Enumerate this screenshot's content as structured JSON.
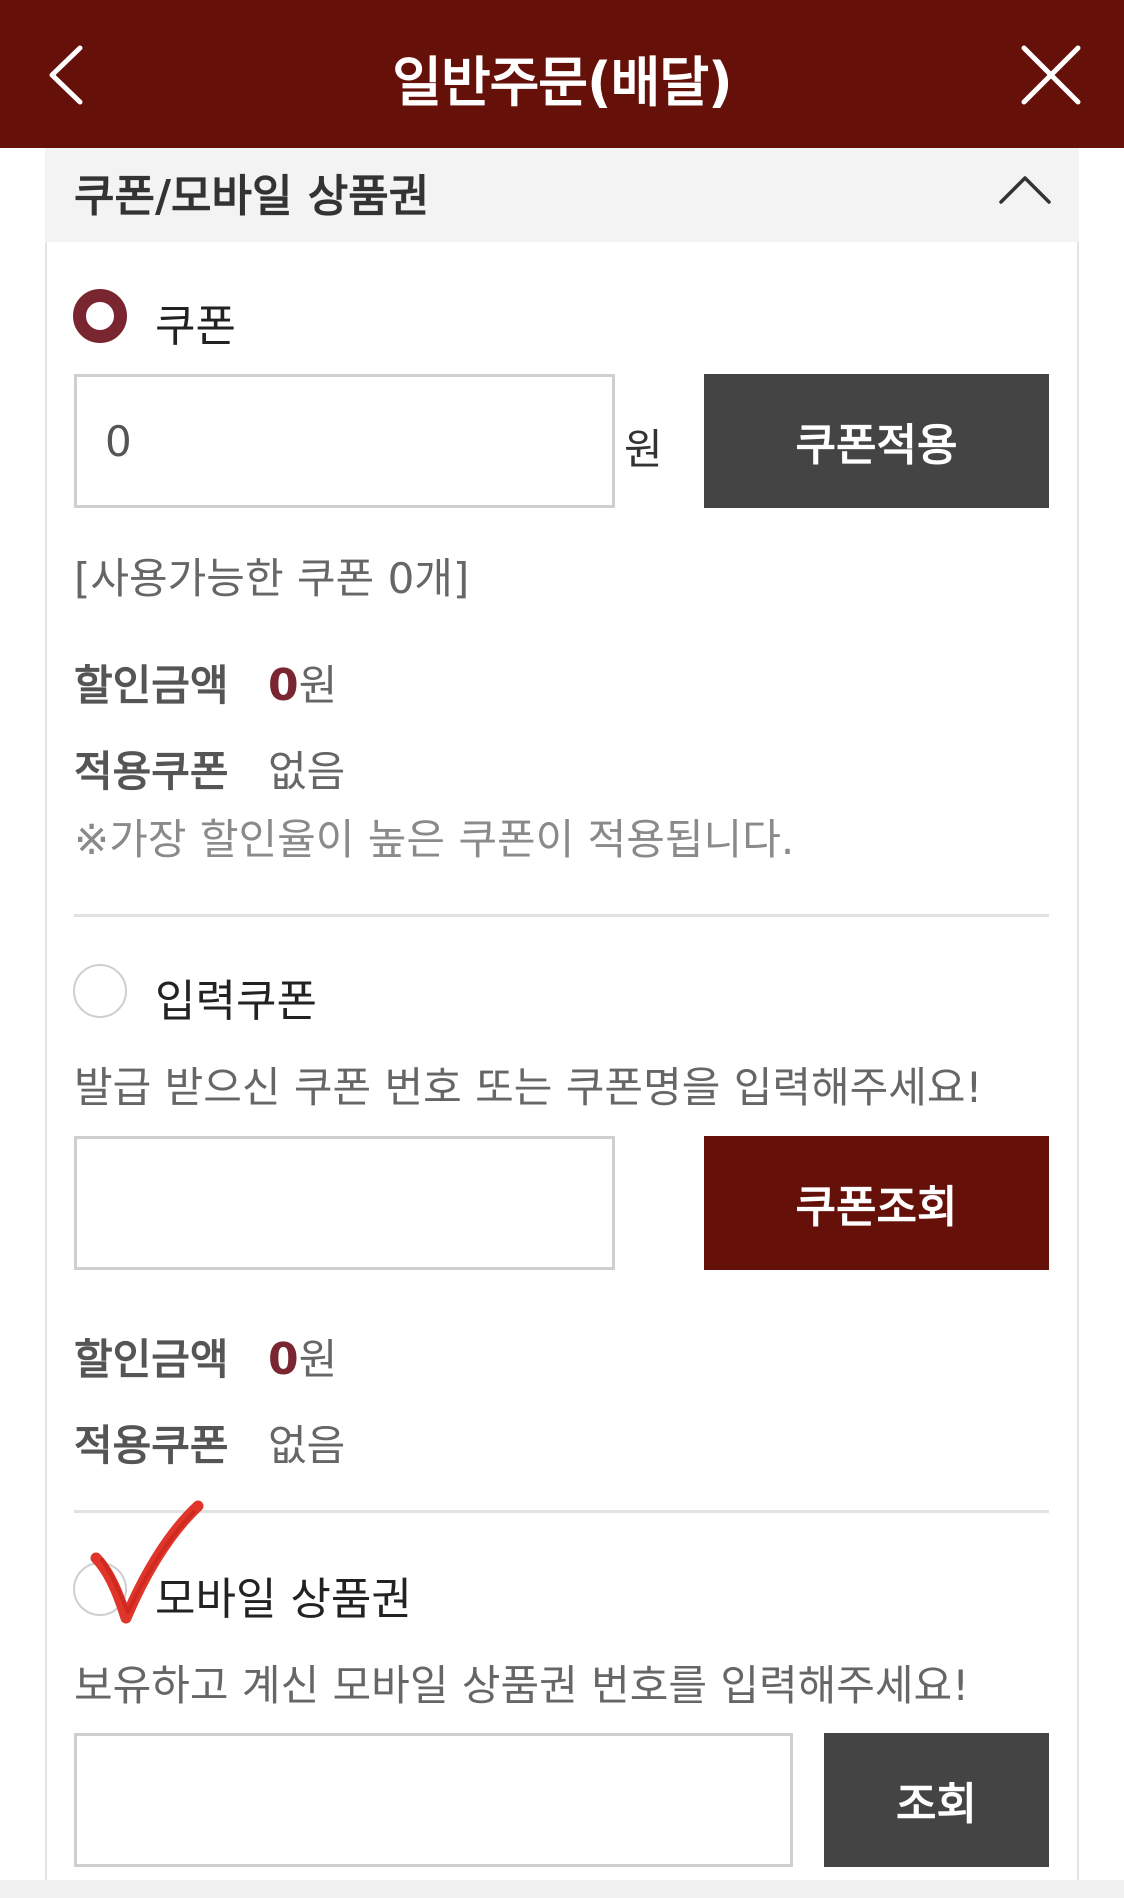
{
  "header": {
    "title": "일반주문(배달)",
    "back_icon": "chevron-left-icon",
    "close_icon": "close-icon"
  },
  "section": {
    "title": "쿠폰/모바일 상품권",
    "toggle_icon": "chevron-up-icon"
  },
  "coupon": {
    "radio_label": "쿠폰",
    "selected": true,
    "amount_value": "0",
    "unit": "원",
    "apply_button": "쿠폰적용",
    "available_text": "[사용가능한 쿠폰 0개]",
    "discount_label": "할인금액",
    "discount_value": "0",
    "discount_unit": "원",
    "applied_label": "적용쿠폰",
    "applied_value": "없음",
    "note": "※가장 할인율이 높은 쿠폰이 적용됩니다."
  },
  "input_coupon": {
    "radio_label": "입력쿠폰",
    "selected": false,
    "description": "발급 받으신 쿠폰 번호 또는 쿠폰명을 입력해주세요!",
    "input_value": "",
    "search_button": "쿠폰조회",
    "discount_label": "할인금액",
    "discount_value": "0",
    "discount_unit": "원",
    "applied_label": "적용쿠폰",
    "applied_value": "없음"
  },
  "mobile_giftcard": {
    "radio_label": "모바일 상품권",
    "selected": false,
    "description": "보유하고 계신 모바일 상품권 번호를 입력해주세요!",
    "input_value": "",
    "search_button": "조회"
  },
  "colors": {
    "header_bg": "#651109",
    "accent": "#7a2631",
    "dark_button": "#444444",
    "annotation_check": "#e0352a"
  }
}
